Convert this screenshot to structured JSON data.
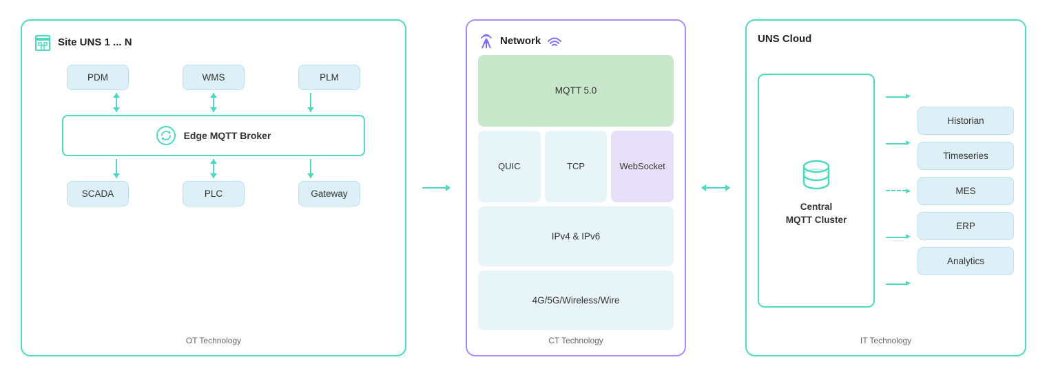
{
  "ot_panel": {
    "site_label": "Site UNS 1 ... N",
    "top_boxes": [
      "PDM",
      "WMS",
      "PLM"
    ],
    "broker_label": "Edge MQTT Broker",
    "bottom_boxes": [
      "SCADA",
      "PLC",
      "Gateway"
    ],
    "footer": "OT Technology"
  },
  "ct_panel": {
    "title": "Network",
    "blocks": {
      "mqtt": "MQTT 5.0",
      "quic": "QUIC",
      "tcp": "TCP",
      "websocket": "WebSocket",
      "ip": "IPv4 & IPv6",
      "wireless": "4G/5G/Wireless/Wire"
    },
    "footer": "CT Technology"
  },
  "uns_panel": {
    "title": "UNS Cloud",
    "cluster_label": "Central\nMQTT Cluster",
    "it_boxes": [
      "Historian",
      "Timeseries",
      "MES",
      "ERP",
      "Analytics"
    ],
    "footer": "IT Technology"
  }
}
